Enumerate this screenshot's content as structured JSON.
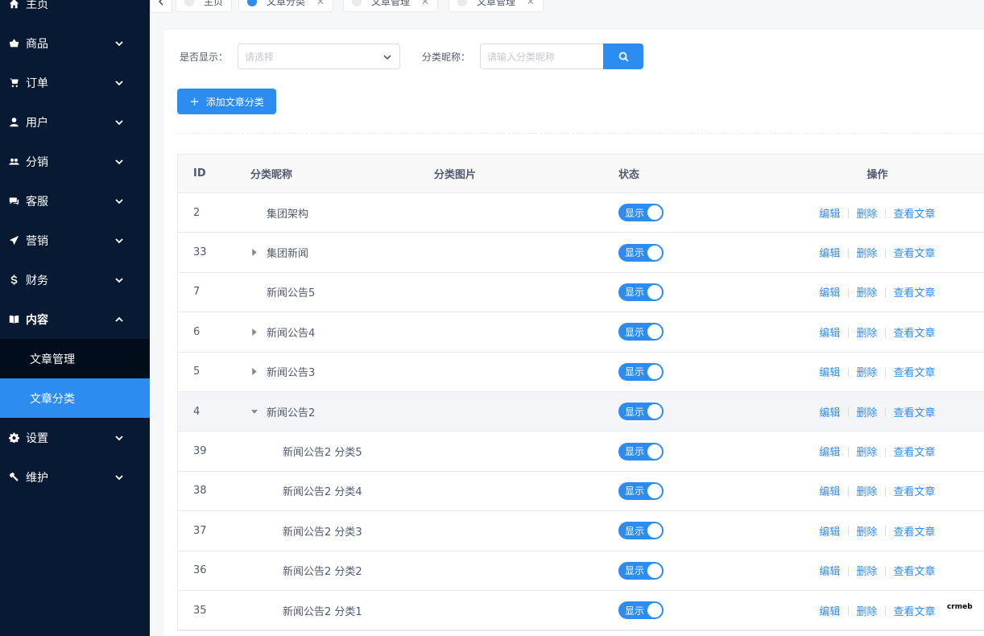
{
  "sidebar": {
    "items": [
      {
        "label": "主页",
        "icon": "home-icon"
      },
      {
        "label": "商品",
        "icon": "basket-icon"
      },
      {
        "label": "订单",
        "icon": "cart-icon"
      },
      {
        "label": "用户",
        "icon": "user-icon"
      },
      {
        "label": "分销",
        "icon": "group-icon"
      },
      {
        "label": "客服",
        "icon": "chat-icon"
      },
      {
        "label": "营销",
        "icon": "send-icon"
      },
      {
        "label": "财务",
        "icon": "dollar-icon"
      },
      {
        "label": "内容",
        "icon": "book-icon"
      },
      {
        "label": "设置",
        "icon": "gear-icon"
      },
      {
        "label": "维护",
        "icon": "hammer-icon"
      }
    ],
    "content_sub": [
      {
        "label": "文章管理"
      },
      {
        "label": "文章分类"
      }
    ]
  },
  "tabs": [
    {
      "label": "主页"
    },
    {
      "label": "文章分类"
    },
    {
      "label": "文章管理"
    },
    {
      "label": "文章管理"
    }
  ],
  "filter": {
    "show_label": "是否显示：",
    "show_placeholder": "请选择",
    "name_label": "分类昵称：",
    "name_placeholder": "请输入分类昵称"
  },
  "add_button_label": "添加文章分类",
  "table": {
    "headers": {
      "id": "ID",
      "name": "分类昵称",
      "image": "分类图片",
      "status": "状态",
      "ops": "操作"
    },
    "status_label": "显示",
    "ops": {
      "edit": "编辑",
      "delete": "删除",
      "view": "查看文章"
    },
    "rows": [
      {
        "id": "2",
        "name": "集团架构",
        "level": 1,
        "expander": "none"
      },
      {
        "id": "33",
        "name": "集团新闻",
        "level": 1,
        "expander": "collapsed"
      },
      {
        "id": "7",
        "name": "新闻公告5",
        "level": 1,
        "expander": "none"
      },
      {
        "id": "6",
        "name": "新闻公告4",
        "level": 1,
        "expander": "collapsed"
      },
      {
        "id": "5",
        "name": "新闻公告3",
        "level": 1,
        "expander": "collapsed"
      },
      {
        "id": "4",
        "name": "新闻公告2",
        "level": 1,
        "expander": "expanded"
      },
      {
        "id": "39",
        "name": "新闻公告2 分类5",
        "level": 2,
        "expander": "none"
      },
      {
        "id": "38",
        "name": "新闻公告2 分类4",
        "level": 2,
        "expander": "none"
      },
      {
        "id": "37",
        "name": "新闻公告2 分类3",
        "level": 2,
        "expander": "none"
      },
      {
        "id": "36",
        "name": "新闻公告2 分类2",
        "level": 2,
        "expander": "none"
      },
      {
        "id": "35",
        "name": "新闻公告2 分类1",
        "level": 2,
        "expander": "none"
      }
    ]
  },
  "watermark": "crmeb",
  "colors": {
    "sidebar_bg": "#081a33",
    "accent": "#2d8cf0",
    "submenu_bg": "#020d1b"
  }
}
